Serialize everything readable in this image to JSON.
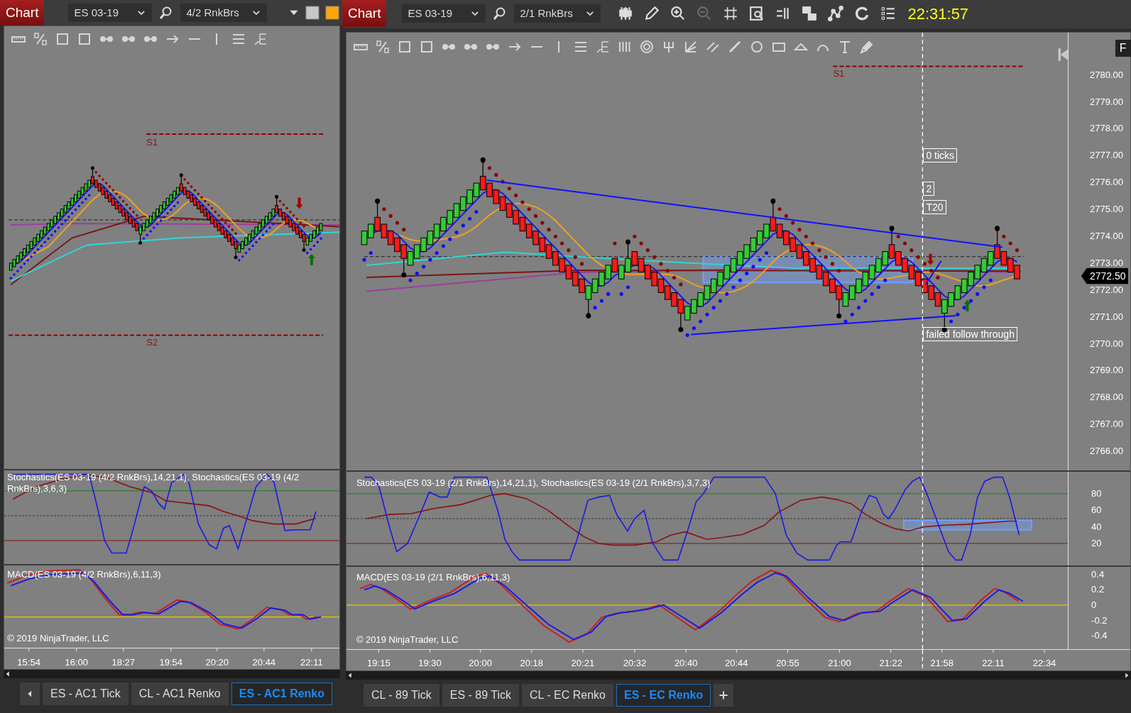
{
  "windows": [
    {
      "title": "Chart",
      "instrument": "ES 03-19",
      "bar_type": "4/2 RnkBrs",
      "levels": [
        {
          "label": "S1"
        },
        {
          "label": "S2"
        }
      ],
      "stochastics": {
        "label": "Stochastics(ES 03-19 (4/2 RnkBrs),14,21,1), Stochastics(ES 03-19 (4/2 RnkBrs),3,6,3)"
      },
      "macd": {
        "label": "MACD(ES 03-19 (4/2 RnkBrs),6,11,3)"
      },
      "copyright": "© 2019 NinjaTrader, LLC",
      "time_axis": [
        "15:54",
        "16:00",
        "18:27",
        "19:54",
        "20:20",
        "20:44",
        "22:11"
      ],
      "tabs": [
        {
          "label": "ES - AC1 Tick",
          "selected": false
        },
        {
          "label": "CL - AC1 Renko",
          "selected": false
        },
        {
          "label": "ES - AC1 Renko",
          "selected": true
        }
      ]
    },
    {
      "title": "Chart",
      "instrument": "ES 03-19",
      "bar_type": "2/1 RnkBrs",
      "clock": "22:31:57",
      "panel_button": "F",
      "levels": [
        {
          "label": "S1"
        }
      ],
      "annotations": [
        {
          "text": "0 ticks"
        },
        {
          "text": "2"
        },
        {
          "text": "T20"
        },
        {
          "text": "failed follow through"
        }
      ],
      "price_axis": [
        "2780.00",
        "2779.00",
        "2778.00",
        "2777.00",
        "2776.00",
        "2775.00",
        "2774.00",
        "2773.00",
        "2772.00",
        "2771.00",
        "2770.00",
        "2769.00",
        "2768.00",
        "2767.00",
        "2766.00"
      ],
      "current_price": "2772.50",
      "stochastics": {
        "label": "Stochastics(ES 03-19 (2/1 RnkBrs),14,21,1), Stochastics(ES 03-19 (2/1 RnkBrs),3,7,3)",
        "axis": [
          "80",
          "60",
          "40",
          "20"
        ]
      },
      "macd": {
        "label": "MACD(ES 03-19 (2/1 RnkBrs),6,11,3)",
        "axis": [
          "0.4",
          "0.2",
          "0",
          "-0.2",
          "-0.4"
        ]
      },
      "copyright": "© 2019 NinjaTrader, LLC",
      "time_axis": [
        "19:15",
        "19:30",
        "20:00",
        "20:18",
        "20:21",
        "20:32",
        "20:40",
        "20:44",
        "20:55",
        "21:00",
        "21:22",
        "21:58",
        "22:11",
        "22:34"
      ],
      "tabs": [
        {
          "label": "CL - 89 Tick",
          "selected": false
        },
        {
          "label": "ES - 89 Tick",
          "selected": false
        },
        {
          "label": "CL - EC Renko",
          "selected": false
        },
        {
          "label": "ES - EC Renko",
          "selected": true
        }
      ]
    }
  ]
}
